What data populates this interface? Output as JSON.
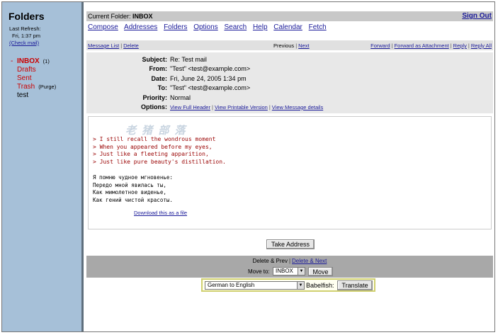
{
  "sidebar": {
    "title": "Folders",
    "refresh_label": "Last Refresh:",
    "refresh_time": "Fri, 1:37 pm",
    "check_mail": "(Check mail)",
    "folders": [
      {
        "name": "INBOX",
        "count": "(1)",
        "dash": "-",
        "extra": ""
      },
      {
        "name": "Drafts",
        "count": "",
        "dash": "",
        "extra": ""
      },
      {
        "name": "Sent",
        "count": "",
        "dash": "",
        "extra": ""
      },
      {
        "name": "Trash",
        "count": "",
        "dash": "",
        "extra": "(Purge)"
      },
      {
        "name": "test",
        "count": "",
        "dash": "",
        "extra": ""
      }
    ]
  },
  "topbar": {
    "label": "Current Folder:",
    "folder": "INBOX",
    "signout": "Sign Out"
  },
  "menu": [
    "Compose",
    "Addresses",
    "Folders",
    "Options",
    "Search",
    "Help",
    "Calendar",
    "Fetch"
  ],
  "nav": {
    "message_list": "Message List",
    "delete": "Delete",
    "previous": "Previous",
    "next": "Next",
    "forward": "Forward",
    "forward_attachment": "Forward as Attachment",
    "reply": "Reply",
    "reply_all": "Reply All"
  },
  "headers": {
    "subject_label": "Subject:",
    "subject": "Re: Test mail",
    "from_label": "From:",
    "from": "\"Test\" <test@example.com>",
    "date_label": "Date:",
    "date": "Fri, June 24, 2005 1:34 pm",
    "to_label": "To:",
    "to": "\"Test\" <test@example.com>",
    "priority_label": "Priority:",
    "priority": "Normal",
    "options_label": "Options:",
    "opt_full_header": "View Full Header",
    "opt_printable": "View Printable Version",
    "opt_details": "View Message details"
  },
  "body": {
    "watermark": "老 猪 部 落",
    "quote": "> I still recall the wondrous moment\n> When you appeared before my eyes,\n> Just like a fleeting apparition,\n> Just like pure beauty's distillation.",
    "russian": "Я помню чудное мгновенье:\nПередо мной явилась ты,\nКак мимолетное виденье,\nКак гений чистой красоты.",
    "download": "Download this as a file"
  },
  "actions": {
    "take_address": "Take Address",
    "delete_prev": "Delete & Prev",
    "delete_next": "Delete & Next",
    "move_to": "Move to:",
    "move_folder": "INBOX",
    "move_button": "Move",
    "translate_lang": "German to English",
    "babelfish": "Babelfish:",
    "translate_button": "Translate"
  }
}
